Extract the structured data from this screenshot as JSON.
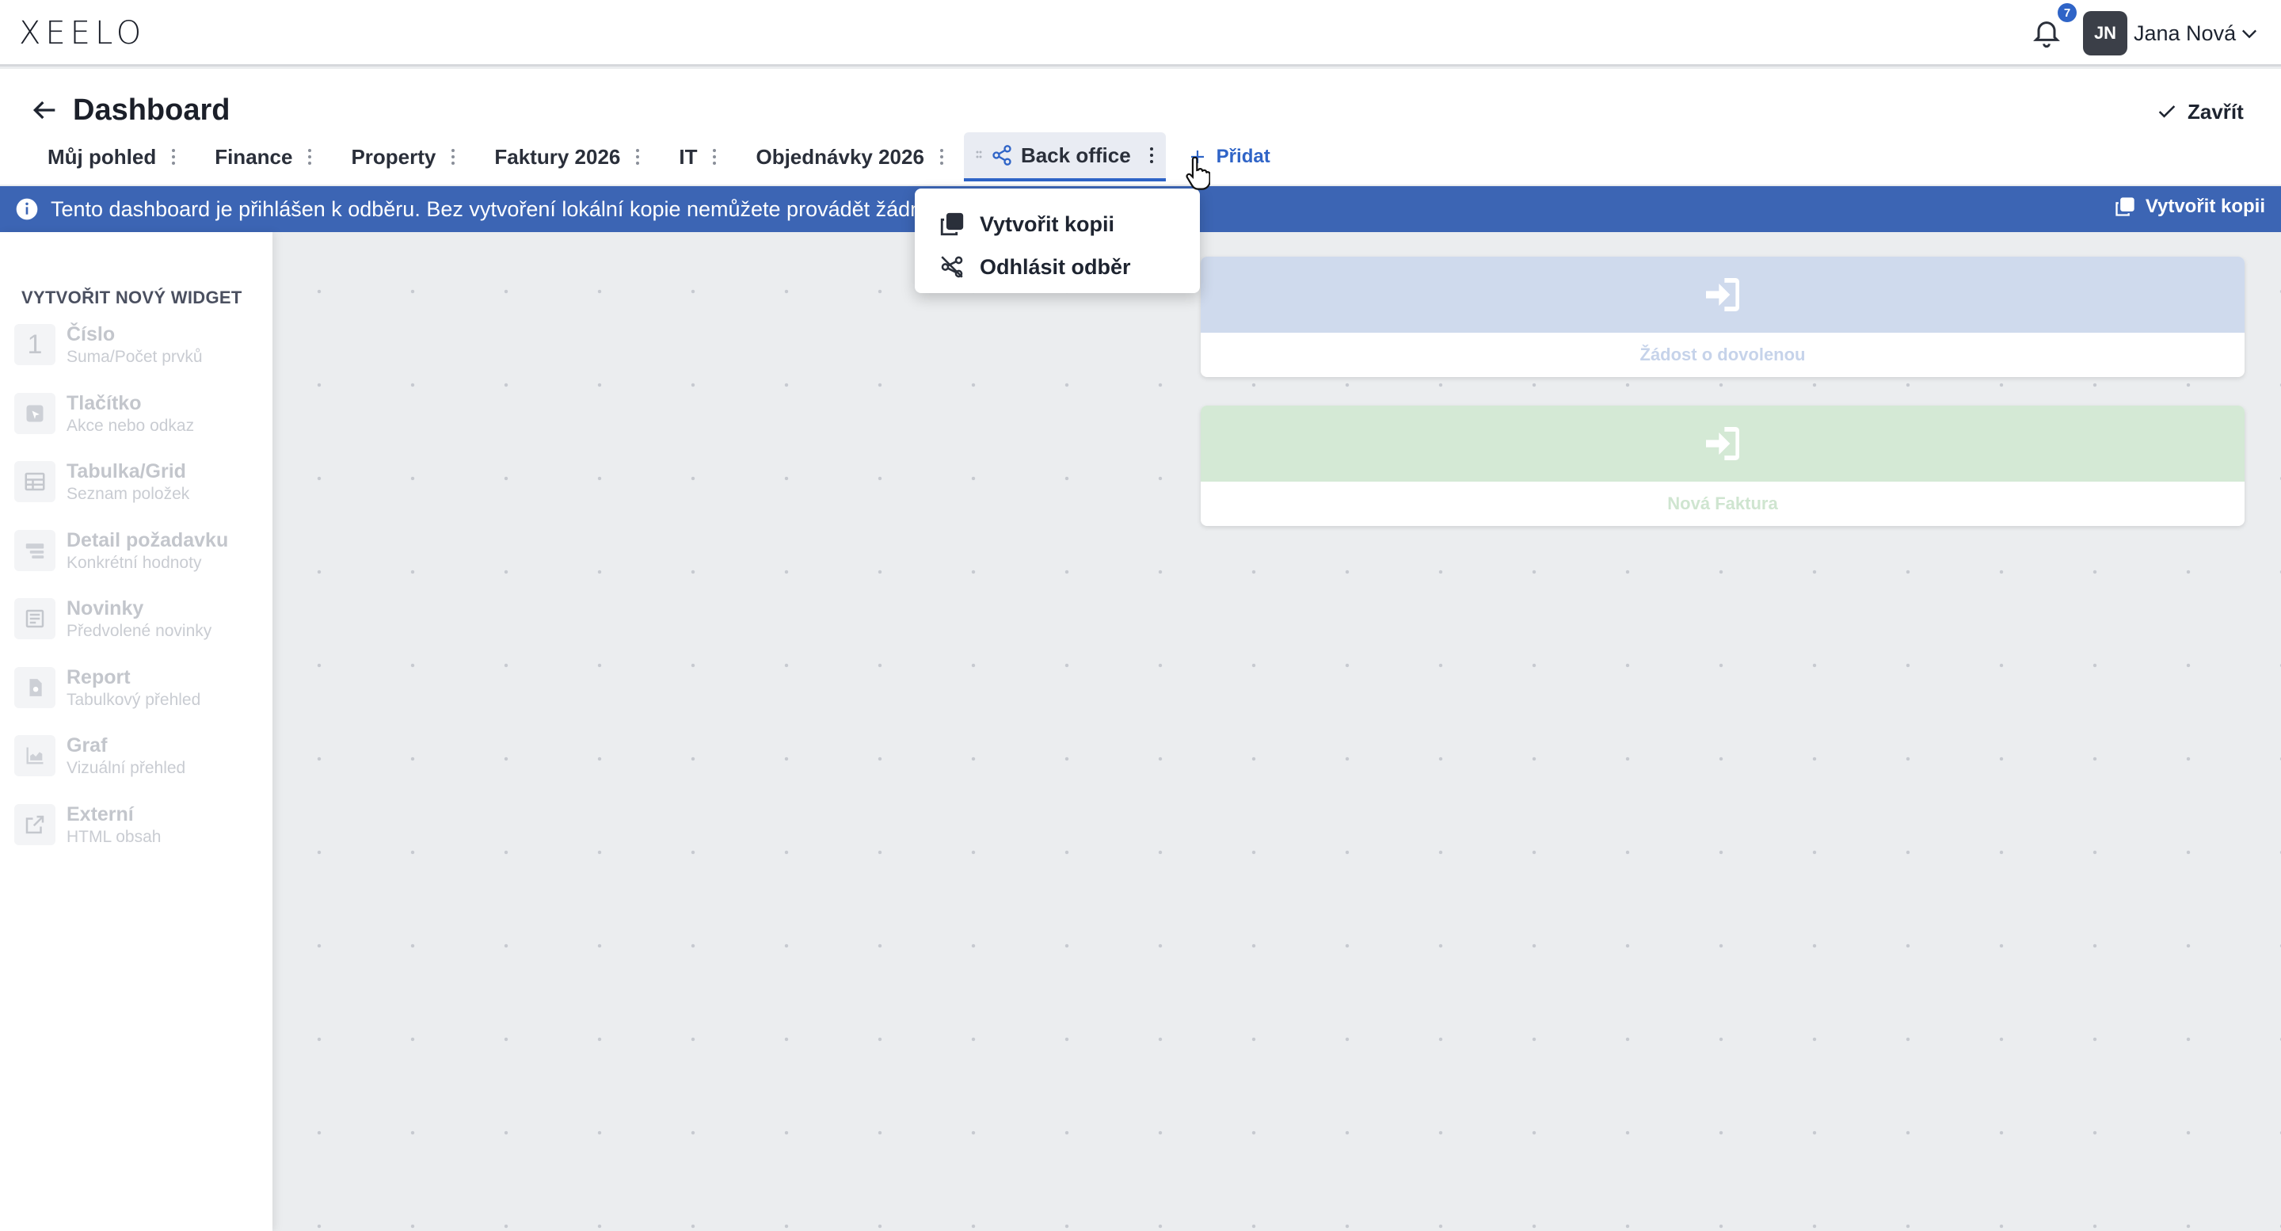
{
  "app": {
    "logo_text": "XEELO"
  },
  "topbar": {
    "notification_count": "7",
    "avatar_initials": "JN",
    "user_name": "Jana Nová"
  },
  "header": {
    "title": "Dashboard",
    "close_label": "Zavřít",
    "add_tab_label": "Přidat",
    "tabs": [
      {
        "label": "Můj pohled"
      },
      {
        "label": "Finance"
      },
      {
        "label": "Property"
      },
      {
        "label": "Faktury 2026"
      },
      {
        "label": "IT"
      },
      {
        "label": "Objednávky 2026"
      },
      {
        "label": "Back office",
        "active": true,
        "shared": true
      }
    ]
  },
  "banner": {
    "message": "Tento dashboard je přihlášen k odběru. Bez vytvoření lokální kopie nemůžete provádět žádné",
    "copy_label": "Vytvořit kopii",
    "color": "#3c65b4"
  },
  "tab_menu": {
    "items": [
      {
        "label": "Vytvořit kopii",
        "icon": "copy-icon"
      },
      {
        "label": "Odhlásit odběr",
        "icon": "unsubscribe-icon"
      }
    ]
  },
  "sidebar": {
    "title": "VYTVOŘIT NOVÝ WIDGET",
    "widgets": [
      {
        "name": "Číslo",
        "sub": "Suma/Počet prvků",
        "icon": "number-icon"
      },
      {
        "name": "Tlačítko",
        "sub": "Akce nebo odkaz",
        "icon": "button-icon"
      },
      {
        "name": "Tabulka/Grid",
        "sub": "Seznam položek",
        "icon": "table-icon"
      },
      {
        "name": "Detail požadavku",
        "sub": "Konkrétní hodnoty",
        "icon": "detail-icon"
      },
      {
        "name": "Novinky",
        "sub": "Předvolené novinky",
        "icon": "news-icon"
      },
      {
        "name": "Report",
        "sub": "Tabulkový přehled",
        "icon": "report-icon"
      },
      {
        "name": "Graf",
        "sub": "Vizuální přehled",
        "icon": "chart-icon"
      },
      {
        "name": "Externí",
        "sub": "HTML obsah",
        "icon": "external-icon"
      }
    ]
  },
  "widgets": [
    {
      "label": "Žádost o dovolenou",
      "color": "#cfdaed",
      "icon": "login-arrow-icon"
    },
    {
      "label": "Nová Faktura",
      "color": "#d4e9d5",
      "icon": "login-arrow-icon"
    }
  ]
}
